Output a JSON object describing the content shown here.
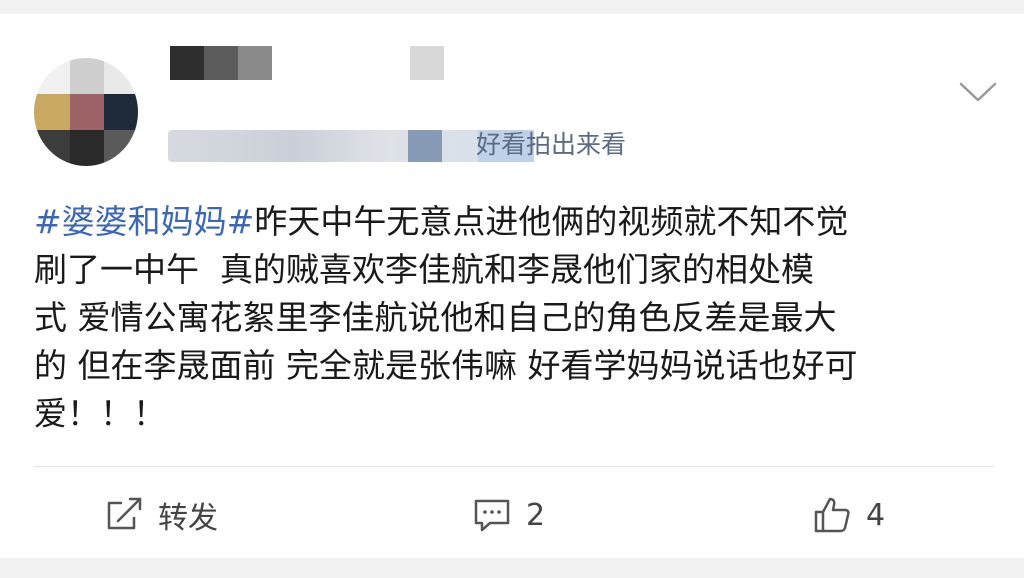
{
  "post": {
    "meta_text": "好看拍出来看",
    "hashtag": "#婆婆和妈妈#",
    "body": "昨天中午无意点进他俩的视频就不知不觉\n刷了一中午  真的贼喜欢李佳航和李晟他们家的相处模\n式 爱情公寓花絮里李佳航说他和自己的角色反差是最大\n的 但在李晟面前 完全就是张伟嘛 好看学妈妈说话也好可\n爱！！！"
  },
  "actions": {
    "repost": {
      "label": "转发",
      "icon": "repost-icon"
    },
    "comment": {
      "count": "2",
      "icon": "comment-icon"
    },
    "like": {
      "count": "4",
      "icon": "thumbs-up-icon"
    }
  },
  "colors": {
    "hashtag": "#3c67b4",
    "body_text": "#1a1a1a",
    "meta_text": "#5a6b86",
    "icon": "#555555"
  }
}
